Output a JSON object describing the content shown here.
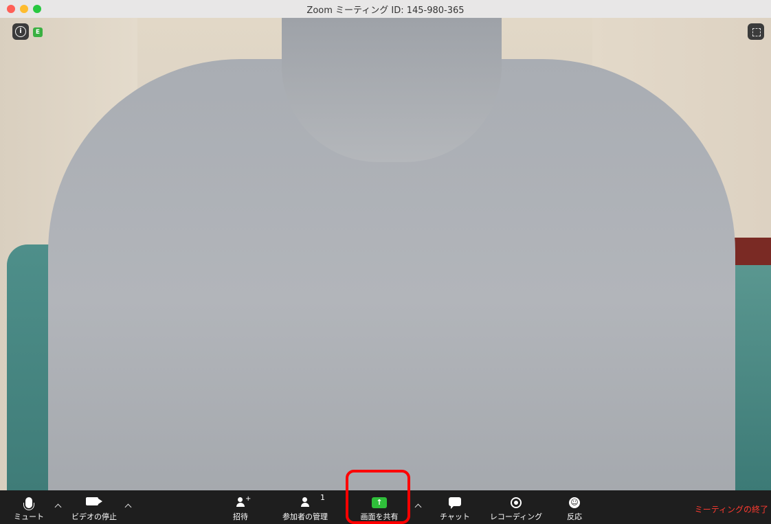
{
  "window": {
    "title": "Zoom ミーティング ID: 145-980-365"
  },
  "overlay": {
    "encryption_badge": "E"
  },
  "toolbar": {
    "mute_label": "ミュート",
    "video_label": "ビデオの停止",
    "invite_label": "招待",
    "participants_label": "参加者の管理",
    "participants_count": "1",
    "share_label": "画面を共有",
    "chat_label": "チャット",
    "record_label": "レコーディング",
    "reactions_label": "反応",
    "end_label": "ミーティングの終了"
  },
  "colors": {
    "share_green": "#2fbf3a",
    "highlight_red": "#ff0000",
    "end_red": "#ff3b30"
  },
  "icons": [
    "info-icon",
    "fullscreen-icon",
    "microphone-icon",
    "video-camera-icon",
    "invite-icon",
    "participants-icon",
    "share-screen-icon",
    "chat-icon",
    "record-icon",
    "reactions-icon"
  ]
}
